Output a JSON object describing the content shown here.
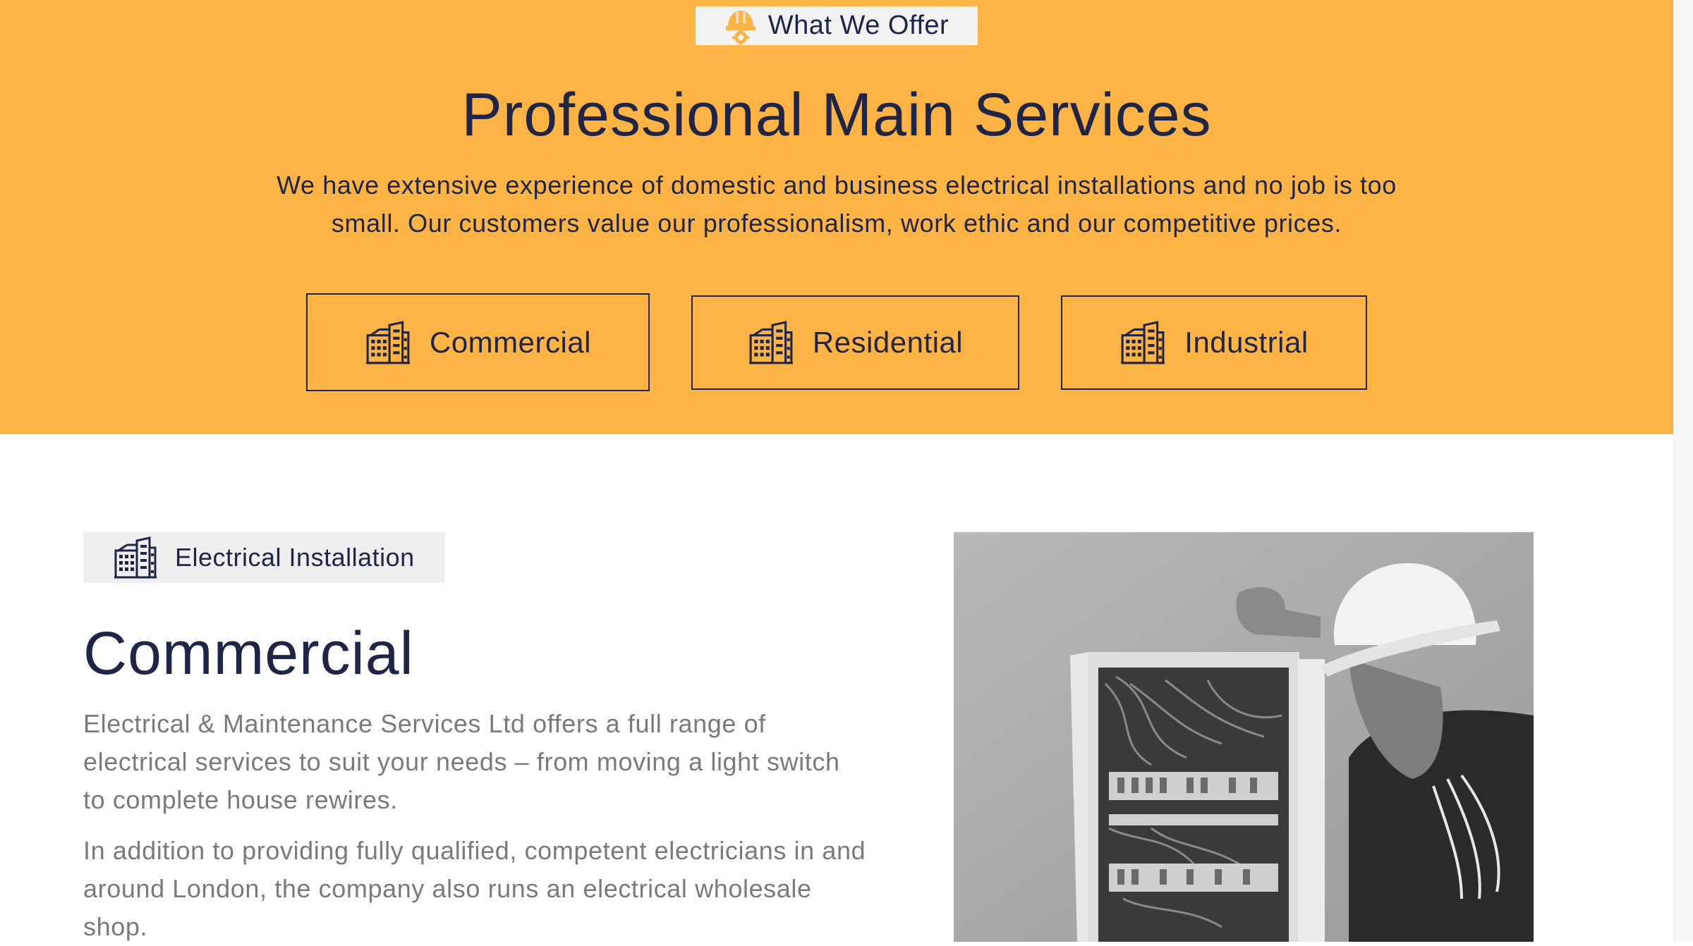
{
  "colors": {
    "hero_bg": "#fdb445",
    "navy": "#1f2547",
    "body_text": "#7a7a7a",
    "badge_bg": "#efefef"
  },
  "hero": {
    "badge": {
      "icon": "hardhat-gear-icon",
      "label": "What We Offer"
    },
    "title": "Professional Main Services",
    "description": "We have extensive experience of domestic and business electrical installations and no job is too small. Our customers value our professionalism, work ethic and our competitive prices.",
    "services": [
      {
        "icon": "buildings-icon",
        "label": "Commercial"
      },
      {
        "icon": "buildings-icon",
        "label": "Residential"
      },
      {
        "icon": "buildings-icon",
        "label": "Industrial"
      }
    ]
  },
  "section": {
    "badge": {
      "icon": "buildings-icon",
      "label": "Electrical Installation"
    },
    "title": "Commercial",
    "paragraphs": [
      "Electrical & Maintenance Services Ltd offers a full range of electrical services to suit your needs – from moving a light switch to complete house rewires.",
      "In addition to providing fully qualified, competent electricians in and around London, the company also runs an electrical wholesale shop."
    ],
    "image": "electrician-photo"
  }
}
